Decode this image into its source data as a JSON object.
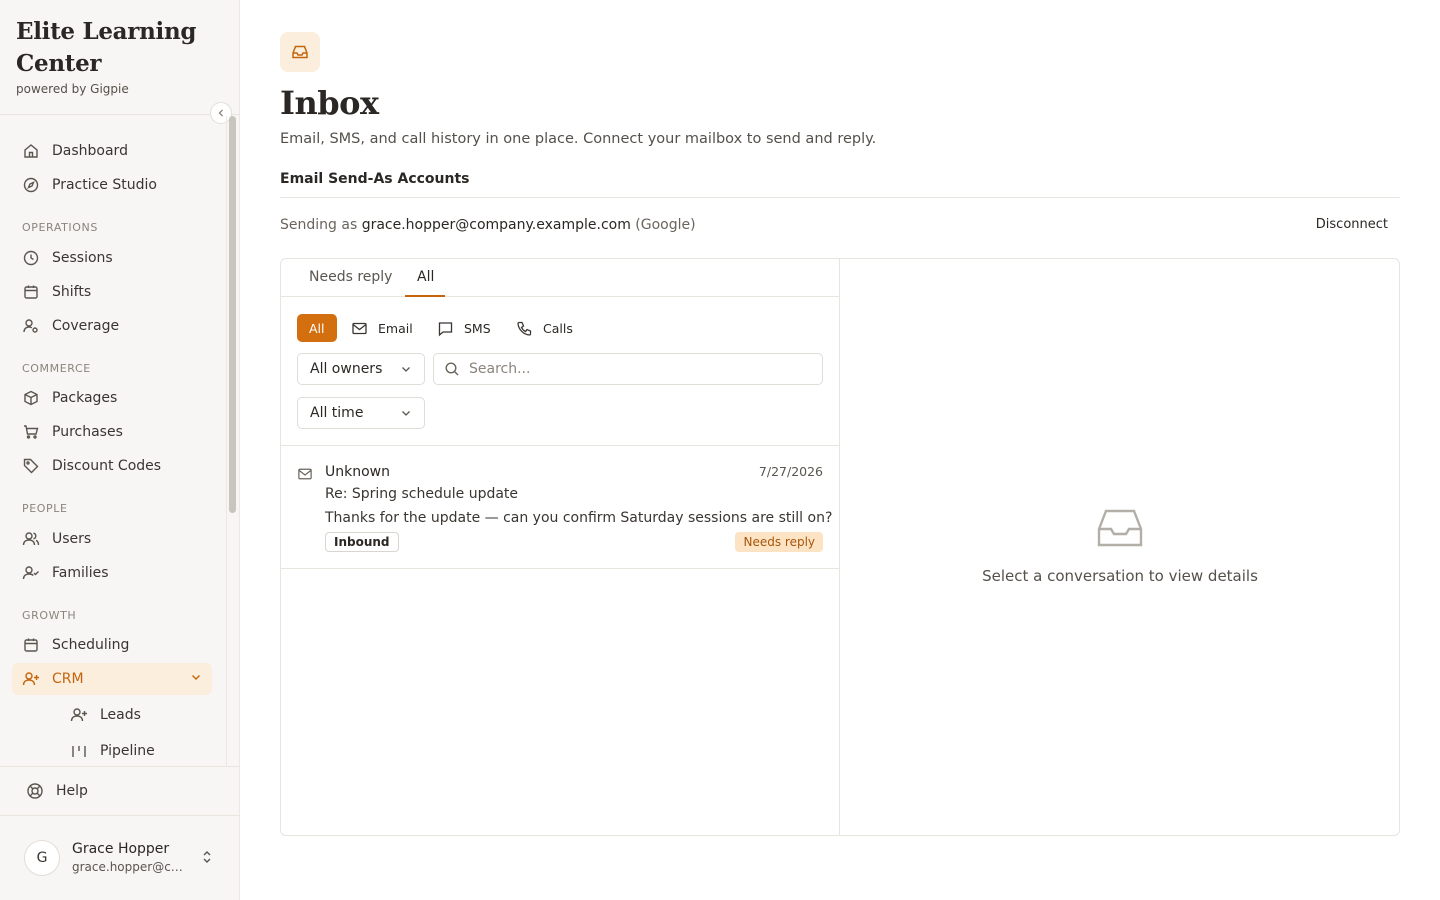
{
  "brand": {
    "title": "Elite Learning Center",
    "subtitle": "powered by Gigpie"
  },
  "nav": {
    "top": [
      {
        "label": "Dashboard",
        "icon": "home-icon"
      },
      {
        "label": "Practice Studio",
        "icon": "compass-icon"
      }
    ],
    "sections": {
      "operations": "OPERATIONS",
      "commerce": "COMMERCE",
      "people": "PEOPLE",
      "growth": "GROWTH"
    },
    "operations": [
      {
        "label": "Sessions",
        "icon": "clock-icon"
      },
      {
        "label": "Shifts",
        "icon": "calendar-icon"
      },
      {
        "label": "Coverage",
        "icon": "user-gear-icon"
      }
    ],
    "commerce": [
      {
        "label": "Packages",
        "icon": "package-icon"
      },
      {
        "label": "Purchases",
        "icon": "cart-icon"
      },
      {
        "label": "Discount Codes",
        "icon": "tag-icon"
      }
    ],
    "people": [
      {
        "label": "Users",
        "icon": "users-icon"
      },
      {
        "label": "Families",
        "icon": "user-check-icon"
      }
    ],
    "growth": [
      {
        "label": "Scheduling",
        "icon": "calendar-icon"
      },
      {
        "label": "CRM",
        "icon": "user-plus-icon",
        "active": true
      },
      {
        "label": "Leads",
        "icon": "user-plus-icon"
      },
      {
        "label": "Pipeline",
        "icon": "pipeline-icon"
      }
    ],
    "help": "Help"
  },
  "user": {
    "initial": "G",
    "name": "Grace Hopper",
    "email": "grace.hopper@company.example.com"
  },
  "page": {
    "title": "Inbox",
    "description": "Email, SMS, and call history in one place. Connect your mailbox to send and reply.",
    "section_title": "Email Send-As Accounts",
    "sending_prefix": "Sending as",
    "sending_email": "grace.hopper@company.example.com",
    "sending_provider": "(Google)",
    "disconnect": "Disconnect"
  },
  "tabs": [
    {
      "label": "Needs reply"
    },
    {
      "label": "All",
      "active": true
    }
  ],
  "channels": [
    {
      "label": "All",
      "active": true
    },
    {
      "label": "Email",
      "icon": "mail-icon"
    },
    {
      "label": "SMS",
      "icon": "chat-icon"
    },
    {
      "label": "Calls",
      "icon": "phone-icon"
    }
  ],
  "filters": {
    "owner": "All owners",
    "time": "All time",
    "search_placeholder": "Search..."
  },
  "conversations": [
    {
      "from": "Unknown",
      "date": "7/27/2026",
      "subject": "Re: Spring schedule update",
      "preview": "Thanks for the update — can you confirm Saturday sessions are still on?",
      "direction": "Inbound",
      "status": "Needs reply"
    }
  ],
  "empty_state": "Select a conversation to view details",
  "colors": {
    "accent": "#d46f0f",
    "accent_bg": "#fbeedd",
    "badge_bg": "#fbe3c4"
  }
}
